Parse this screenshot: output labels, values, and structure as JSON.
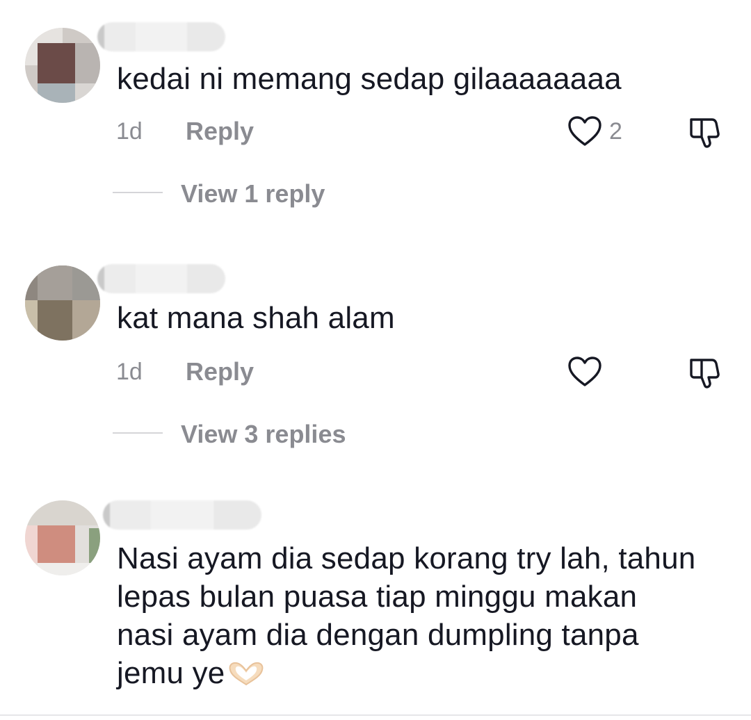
{
  "comments": [
    {
      "text": "kedai ni memang sedap gilaaaaaaaa",
      "time": "1d",
      "reply_label": "Reply",
      "like_count": "2",
      "view_replies_label": "View 1 reply",
      "avatar_icon": "blurred-avatar",
      "liked": false
    },
    {
      "text": "kat mana shah alam",
      "time": "1d",
      "reply_label": "Reply",
      "like_count": "",
      "view_replies_label": "View 3 replies",
      "avatar_icon": "blurred-avatar",
      "liked": false
    },
    {
      "text_lines": [
        "Nasi ayam dia sedap korang try lah, tahun",
        "lepas bulan puasa tiap minggu makan",
        "nasi ayam dia dengan dumpling tanpa",
        "jemu ye"
      ],
      "emoji": "heart-hands-emoji",
      "avatar_icon": "blurred-avatar"
    }
  ],
  "icons": {
    "like": "heart-outline-icon",
    "dislike": "thumbs-down-outline-icon"
  },
  "colors": {
    "text": "#161823",
    "secondary": "#8a8b91",
    "divider": "#d5d5d8"
  }
}
